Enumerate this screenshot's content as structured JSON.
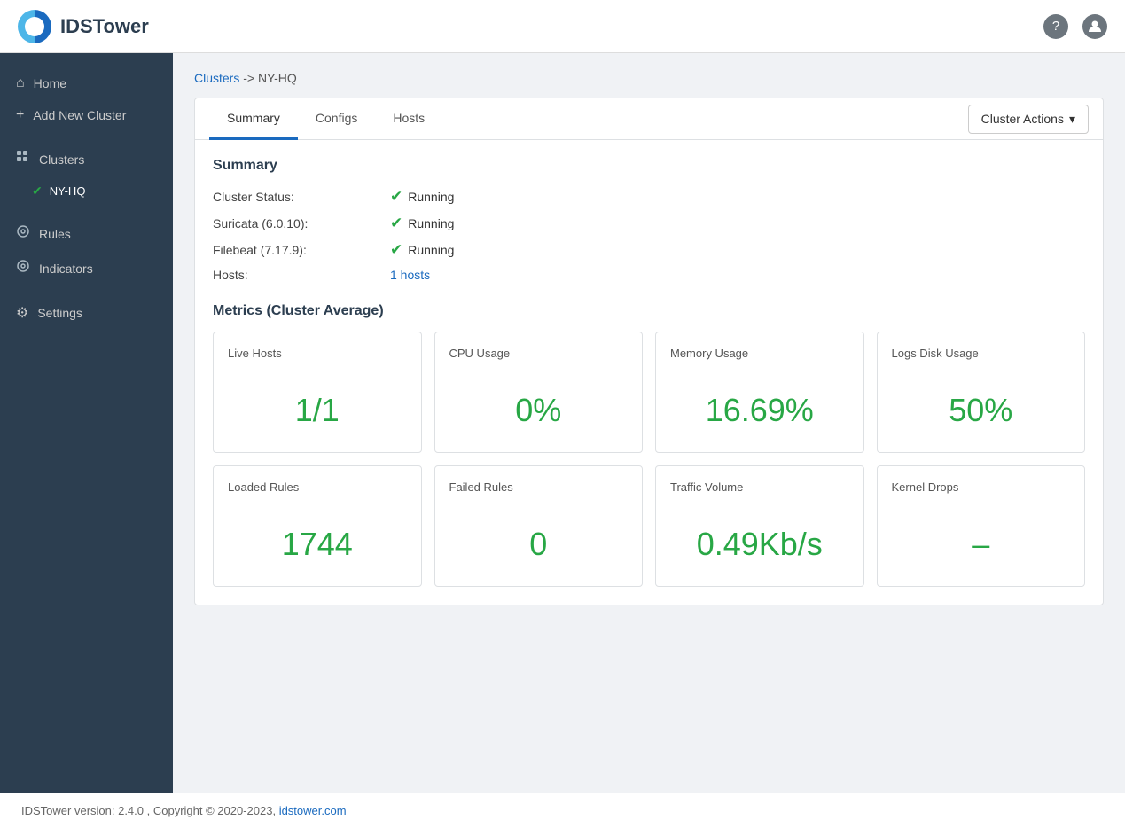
{
  "app": {
    "brand": "IDSTower",
    "help_icon": "?",
    "user_icon": "👤"
  },
  "sidebar": {
    "nav": [
      {
        "id": "home",
        "label": "Home",
        "icon": "⌂",
        "active": false
      },
      {
        "id": "add-new-cluster",
        "label": "Add New Cluster",
        "icon": "＋",
        "active": false
      }
    ],
    "clusters_label": "Clusters",
    "clusters": [
      {
        "id": "ny-hq",
        "label": "NY-HQ",
        "active": true
      }
    ],
    "rules": {
      "label": "Rules",
      "icon": "◎"
    },
    "indicators": {
      "label": "Indicators",
      "icon": "◎"
    },
    "settings": {
      "label": "Settings",
      "icon": "⚙"
    }
  },
  "breadcrumb": {
    "link_text": "Clusters",
    "separator": "->",
    "current": "NY-HQ"
  },
  "tabs": [
    {
      "id": "summary",
      "label": "Summary",
      "active": true
    },
    {
      "id": "configs",
      "label": "Configs",
      "active": false
    },
    {
      "id": "hosts",
      "label": "Hosts",
      "active": false
    }
  ],
  "cluster_actions": {
    "label": "Cluster Actions",
    "dropdown_icon": "▾"
  },
  "summary": {
    "section_title": "Summary",
    "fields": [
      {
        "label": "Cluster Status:",
        "value": "Running",
        "has_icon": true
      },
      {
        "label": "Suricata (6.0.10):",
        "value": "Running",
        "has_icon": true
      },
      {
        "label": "Filebeat (7.17.9):",
        "value": "Running",
        "has_icon": true
      },
      {
        "label": "Hosts:",
        "value": "1 hosts",
        "is_link": true,
        "has_icon": false
      }
    ]
  },
  "metrics": {
    "section_title": "Metrics (Cluster Average)",
    "cards": [
      {
        "label": "Live Hosts",
        "value": "1/1"
      },
      {
        "label": "CPU Usage",
        "value": "0%"
      },
      {
        "label": "Memory Usage",
        "value": "16.69%"
      },
      {
        "label": "Logs Disk Usage",
        "value": "50%"
      }
    ],
    "cards2": [
      {
        "label": "Loaded Rules",
        "value": "1744"
      },
      {
        "label": "Failed Rules",
        "value": "0"
      },
      {
        "label": "Traffic Volume",
        "value": "0.49Kb/s"
      },
      {
        "label": "Kernel Drops",
        "value": "–"
      }
    ]
  },
  "footer": {
    "text_before_link": "IDSTower version: 2.4.0 , Copyright © 2020-2023,",
    "link_text": "idstower.com",
    "link_href": "#"
  }
}
